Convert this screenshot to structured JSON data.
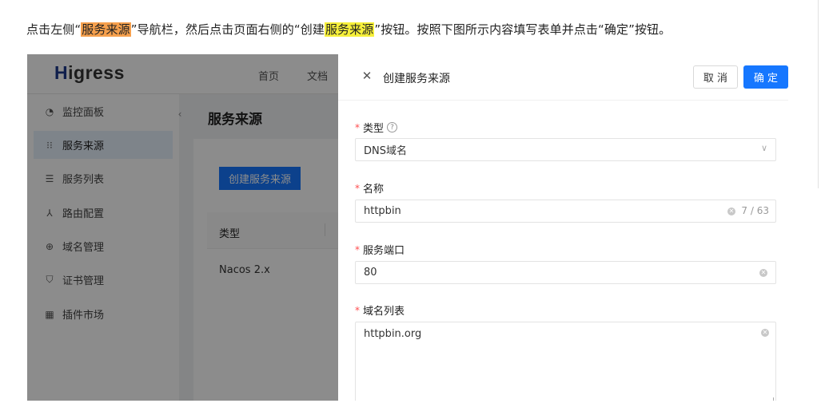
{
  "instruction": {
    "part1": "点击左侧“",
    "highlight1": "服务来源",
    "part2": "”导航栏，然后点击页面右侧的“创建",
    "highlight2": "服务来源",
    "part3": "”按钮。按照下图所示内容填写表单并点击“确定”按钮。"
  },
  "app": {
    "logo_first": "H",
    "logo_rest": "igress",
    "top_nav": [
      "首页",
      "文档"
    ],
    "sidebar": [
      {
        "label": "监控面板",
        "icon": "dashboard-icon",
        "glyph": "◔"
      },
      {
        "label": "服务来源",
        "icon": "service-source-icon",
        "glyph": "⁝⁝"
      },
      {
        "label": "服务列表",
        "icon": "list-icon",
        "glyph": "☰"
      },
      {
        "label": "路由配置",
        "icon": "route-icon",
        "glyph": "⅄"
      },
      {
        "label": "域名管理",
        "icon": "globe-icon",
        "glyph": "⊕"
      },
      {
        "label": "证书管理",
        "icon": "shield-icon",
        "glyph": "⛉"
      },
      {
        "label": "插件市场",
        "icon": "plugin-icon",
        "glyph": "▦"
      }
    ],
    "sidebar_active_index": 1,
    "main_title": "服务来源",
    "create_button": "创建服务来源",
    "table": {
      "header_type": "类型",
      "row1_type": "Nacos 2.x"
    }
  },
  "drawer": {
    "title": "创建服务来源",
    "cancel": "取 消",
    "confirm": "确 定",
    "fields": {
      "type": {
        "label": "类型",
        "value": "DNS域名"
      },
      "name": {
        "label": "名称",
        "value": "httpbin",
        "counter": "7 / 63"
      },
      "port": {
        "label": "服务端口",
        "value": "80"
      },
      "domains": {
        "label": "域名列表",
        "value": "httpbin.org"
      }
    }
  },
  "colors": {
    "highlight_orange": "#f6a04d",
    "highlight_yellow": "#f7f03a",
    "primary": "#1677ff",
    "required": "#ff4d4f"
  }
}
